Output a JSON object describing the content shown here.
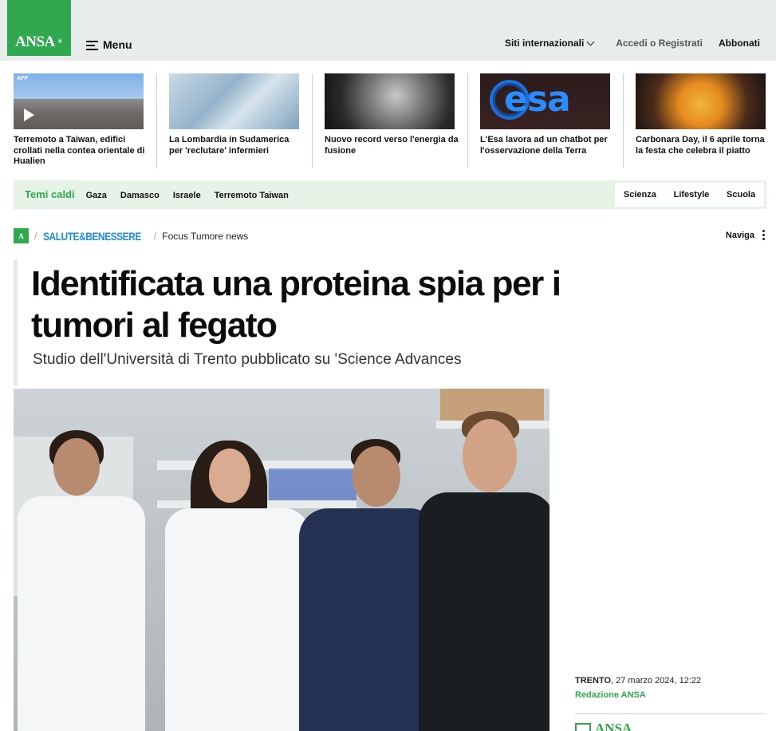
{
  "header": {
    "logo_text": "ANSA",
    "logo_suffix": "it",
    "menu_label": "Menu",
    "siti_label": "Siti internazionali",
    "login_label": "Accedi o Registrati",
    "subscribe_label": "Abbonati"
  },
  "news_strip": [
    {
      "title": "Terremoto a Taiwan, edifici crollati nella contea orientale di Hualien",
      "badge": "AFP"
    },
    {
      "title": "La Lombardia in Sudamerica per 'reclutare' infermieri"
    },
    {
      "title": "Nuovo record verso l'energia da fusione"
    },
    {
      "title": "L'Esa lavora ad un chatbot per l'osservazione della Terra",
      "image_text": "esa"
    },
    {
      "title": "Carbonara Day, il 6 aprile torna la festa che celebra il piatto"
    }
  ],
  "hot_topics": {
    "title": "Temi caldi",
    "items": [
      "Gaza",
      "Damasco",
      "Israele",
      "Terremoto Taiwan"
    ],
    "sections": [
      "Scienza",
      "Lifestyle",
      "Scuola"
    ]
  },
  "breadcrumb": {
    "logo_text": "A",
    "section": "SALUTE&BENESSERE",
    "page": "Focus Tumore news",
    "nav_label": "Naviga"
  },
  "article": {
    "title": "Identificata una proteina spia per i tumori al fegato",
    "subtitle": "Studio dell'Università di Trento pubblicato su 'Science Advances",
    "location": "TRENTO",
    "date": ", 27 marzo 2024, 12:22",
    "author": "Redazione ANSA",
    "bottom_logo": "ANSA"
  },
  "colors": {
    "brand_green": "#2fa84f",
    "section_blue": "#1a8fe0",
    "header_bg": "#e9ecec",
    "topics_bg": "#e6f3e6"
  }
}
